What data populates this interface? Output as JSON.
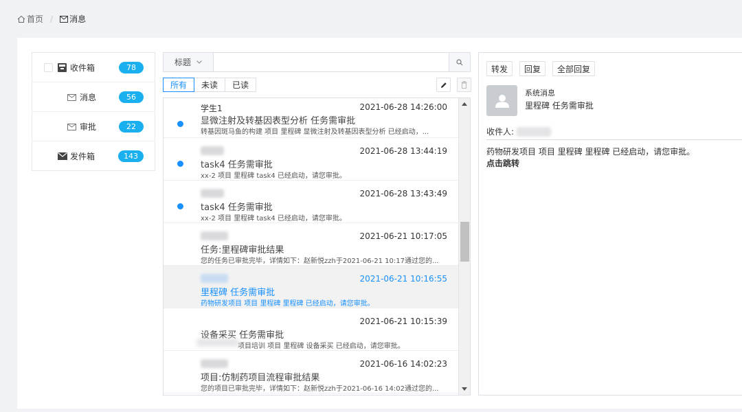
{
  "breadcrumb": {
    "home": "首页",
    "current": "消息"
  },
  "folders": [
    {
      "label": "收件箱",
      "count": "78"
    },
    {
      "label": "消息",
      "count": "56"
    },
    {
      "label": "审批",
      "count": "22"
    },
    {
      "label": "发件箱",
      "count": "143"
    }
  ],
  "search": {
    "field": "标题",
    "value": ""
  },
  "filters": [
    "所有",
    "未读",
    "已读"
  ],
  "messages": [
    {
      "sender": "学生1",
      "time": "2021-06-28 14:26:00",
      "subject": "显微注射及转基因表型分析 任务需审批",
      "preview": "转基因斑马鱼的构建 项目 里程碑 显微注射及转基因表型分析 已经启动，..."
    },
    {
      "sender": "",
      "time": "2021-06-28 13:44:19",
      "subject": "task4 任务需审批",
      "preview": "xx-2 项目 里程碑 task4 已经启动，请您审批。"
    },
    {
      "sender": "",
      "time": "2021-06-28 13:43:49",
      "subject": "task4 任务需审批",
      "preview": "xx-2 项目 里程碑 task4 已经启动，请您审批。"
    },
    {
      "sender": "",
      "time": "2021-06-21 10:17:05",
      "subject": "任务:里程碑审批结果",
      "preview": "您的任务已审批完毕，详情如下：赵新悦zzh于2021-06-21 10:17通过您的..."
    },
    {
      "sender": "",
      "time": "2021-06-21 10:16:55",
      "subject": "里程碑 任务需审批",
      "preview": "药物研发项目 项目 里程碑 里程碑 已经启动，请您审批。"
    },
    {
      "sender": "",
      "time": "2021-06-21 10:15:39",
      "subject": "设备采买 任务需审批",
      "preview": "项目培训 项目 里程碑 设备采买 已经启动，请您审批。"
    },
    {
      "sender": "",
      "time": "2021-06-16 14:02:23",
      "subject": "项目:仿制药项目流程审批结果",
      "preview": "您的项目已审批完毕，详情如下：赵新悦zzh于2021-06-16 14:02通过您的..."
    }
  ],
  "detail": {
    "actions": [
      "转发",
      "回复",
      "全部回复"
    ],
    "sender": "系统消息",
    "subject": "里程碑 任务需审批",
    "recipient_label": "收件人:",
    "body": "药物研发项目 项目 里程碑 里程碑 已经启动，请您审批。",
    "link": "点击跳转"
  }
}
